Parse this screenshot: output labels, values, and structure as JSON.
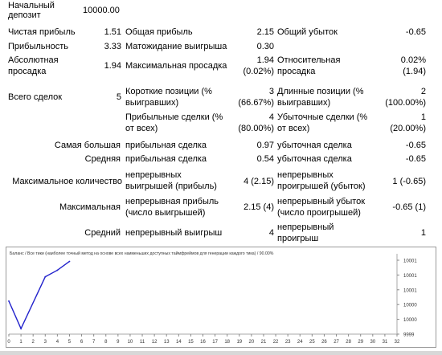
{
  "report": {
    "initial_deposit": {
      "label1": "Начальный",
      "label2": "депозит",
      "value": "10000.00"
    },
    "row_net": {
      "l1": "Чистая прибыль",
      "v1": "1.51",
      "l2": "Общая прибыль",
      "v2": "2.15",
      "l3": "Общий убыток",
      "v3": "-0.65"
    },
    "row_pf": {
      "l1": "Прибыльность",
      "v1": "3.33",
      "l2": "Матожидание выигрыша",
      "v2": "0.30"
    },
    "row_dd": {
      "l1a": "Абсолютная",
      "l1b": "просадка",
      "v1": "1.94",
      "l2": "Максимальная просадка",
      "v2a": "1.94",
      "v2b": "(0.02%)",
      "l3a": "Относительная",
      "l3b": "просадка",
      "v3a": "0.02%",
      "v3b": "(1.94)"
    },
    "row_trades": {
      "l1": "Всего сделок",
      "v1": "5",
      "l2a": "Короткие позиции (%",
      "l2b": "выигравших)",
      "v2a": "3",
      "v2b": "(66.67%)",
      "l3a": "Длинные позиции (%",
      "l3b": "выигравших)",
      "v3a": "2",
      "v3b": "(100.00%)"
    },
    "row_pt": {
      "l2a": "Прибыльные сделки (%",
      "l2b": "от всех)",
      "v2a": "4",
      "v2b": "(80.00%)",
      "l3a": "Убыточные сделки (%",
      "l3b": "от всех)",
      "v3a": "1",
      "v3b": "(20.00%)"
    },
    "row_largest": {
      "l1": "Самая большая",
      "l2": "прибыльная сделка",
      "v2": "0.97",
      "l3": "убыточная сделка",
      "v3": "-0.65"
    },
    "row_avg": {
      "l1": "Средняя",
      "l2": "прибыльная сделка",
      "v2": "0.54",
      "l3": "убыточная сделка",
      "v3": "-0.65"
    },
    "row_maxcons": {
      "l1": "Максимальное количество",
      "l2a": "непрерывных",
      "l2b": "выигрышей (прибыль)",
      "v2": "4 (2.15)",
      "l3a": "непрерывных",
      "l3b": "проигрышей (убыток)",
      "v3": "1 (-0.65)"
    },
    "row_maxcons2": {
      "l1": "Максимальная",
      "l2a": "непрерывная прибыль",
      "l2b": "(число выигрышей)",
      "v2": "2.15 (4)",
      "l3a": "непрерывный убыток",
      "l3b": "(число проигрышей)",
      "v3": "-0.65 (1)"
    },
    "row_avgcons": {
      "l1": "Средний",
      "l2": "непрерывный выигрыш",
      "v2": "4",
      "l3a": "непрерывный",
      "l3b": "проигрыш",
      "v3": "1"
    }
  },
  "chart_data": {
    "type": "line",
    "title": "Баланс / Все тики (наиболее точный метод на основе всех наименьших доступных таймфреймов для генерации каждого тика) / 90.00%",
    "x": [
      0,
      1,
      3,
      4,
      5
    ],
    "y": [
      10000.5,
      9999.25,
      10001.6,
      10001.9,
      10002.3
    ],
    "xticks": [
      "0",
      "1",
      "2",
      "3",
      "4",
      "5",
      "6",
      "7",
      "8",
      "9",
      "10",
      "11",
      "12",
      "13",
      "14",
      "15",
      "16",
      "17",
      "18",
      "19",
      "20",
      "21",
      "22",
      "23",
      "24",
      "25",
      "26",
      "27",
      "28",
      "29",
      "30",
      "31",
      "32"
    ],
    "yticks": [
      "10001",
      "10001",
      "10001",
      "10000",
      "10000",
      "9999"
    ],
    "xlim": [
      0,
      32
    ],
    "ylim": [
      9999,
      10002.5
    ],
    "series_color": "#2222cc"
  }
}
